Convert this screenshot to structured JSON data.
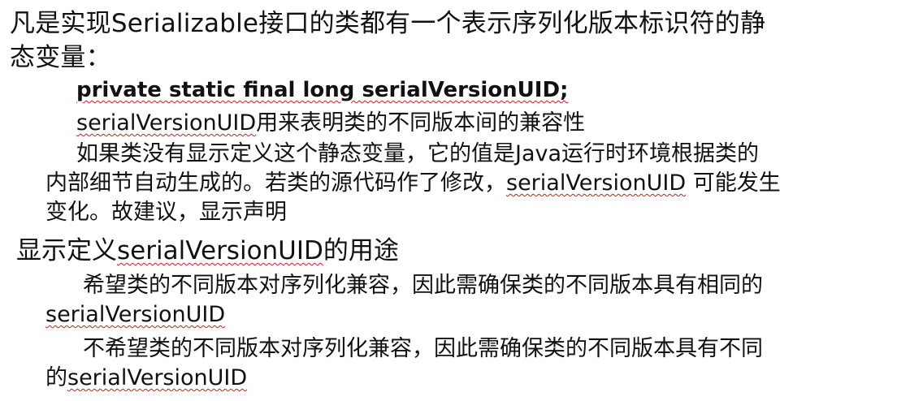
{
  "heading": {
    "prefix": "凡是实现",
    "keyword": "Serializable",
    "suffix": "接口的类都有一个表示序列化版本标识符的静",
    "line2": "态变量："
  },
  "declaration": {
    "code": "private static final long serialVersionUID;"
  },
  "purpose": {
    "keyword": "serialVersionUID",
    "text": "用来表明类的不同版本间的兼容性"
  },
  "auto": {
    "line1": "如果类没有显示定义这个静态变量，它的值是Java运行时环境根据类的",
    "line2_prefix": "内部细节自动生成的。若类的源代码作了修改，",
    "line2_keyword": "serialVersionUID",
    "line2_suffix": " 可能发生",
    "line3": "变化。故建议，显示声明"
  },
  "uses_heading": {
    "prefix": "显示定义",
    "keyword": "serialVersionUID",
    "suffix": "的用途"
  },
  "use1": {
    "line1": "希望类的不同版本对序列化兼容，因此需确保类的不同版本具有相同的",
    "line2_keyword": "serialVersionUID"
  },
  "use2": {
    "line1": "不希望类的不同版本对序列化兼容，因此需确保类的不同版本具有不同",
    "line2_prefix": "的",
    "line2_keyword": "serialVersionUID"
  }
}
